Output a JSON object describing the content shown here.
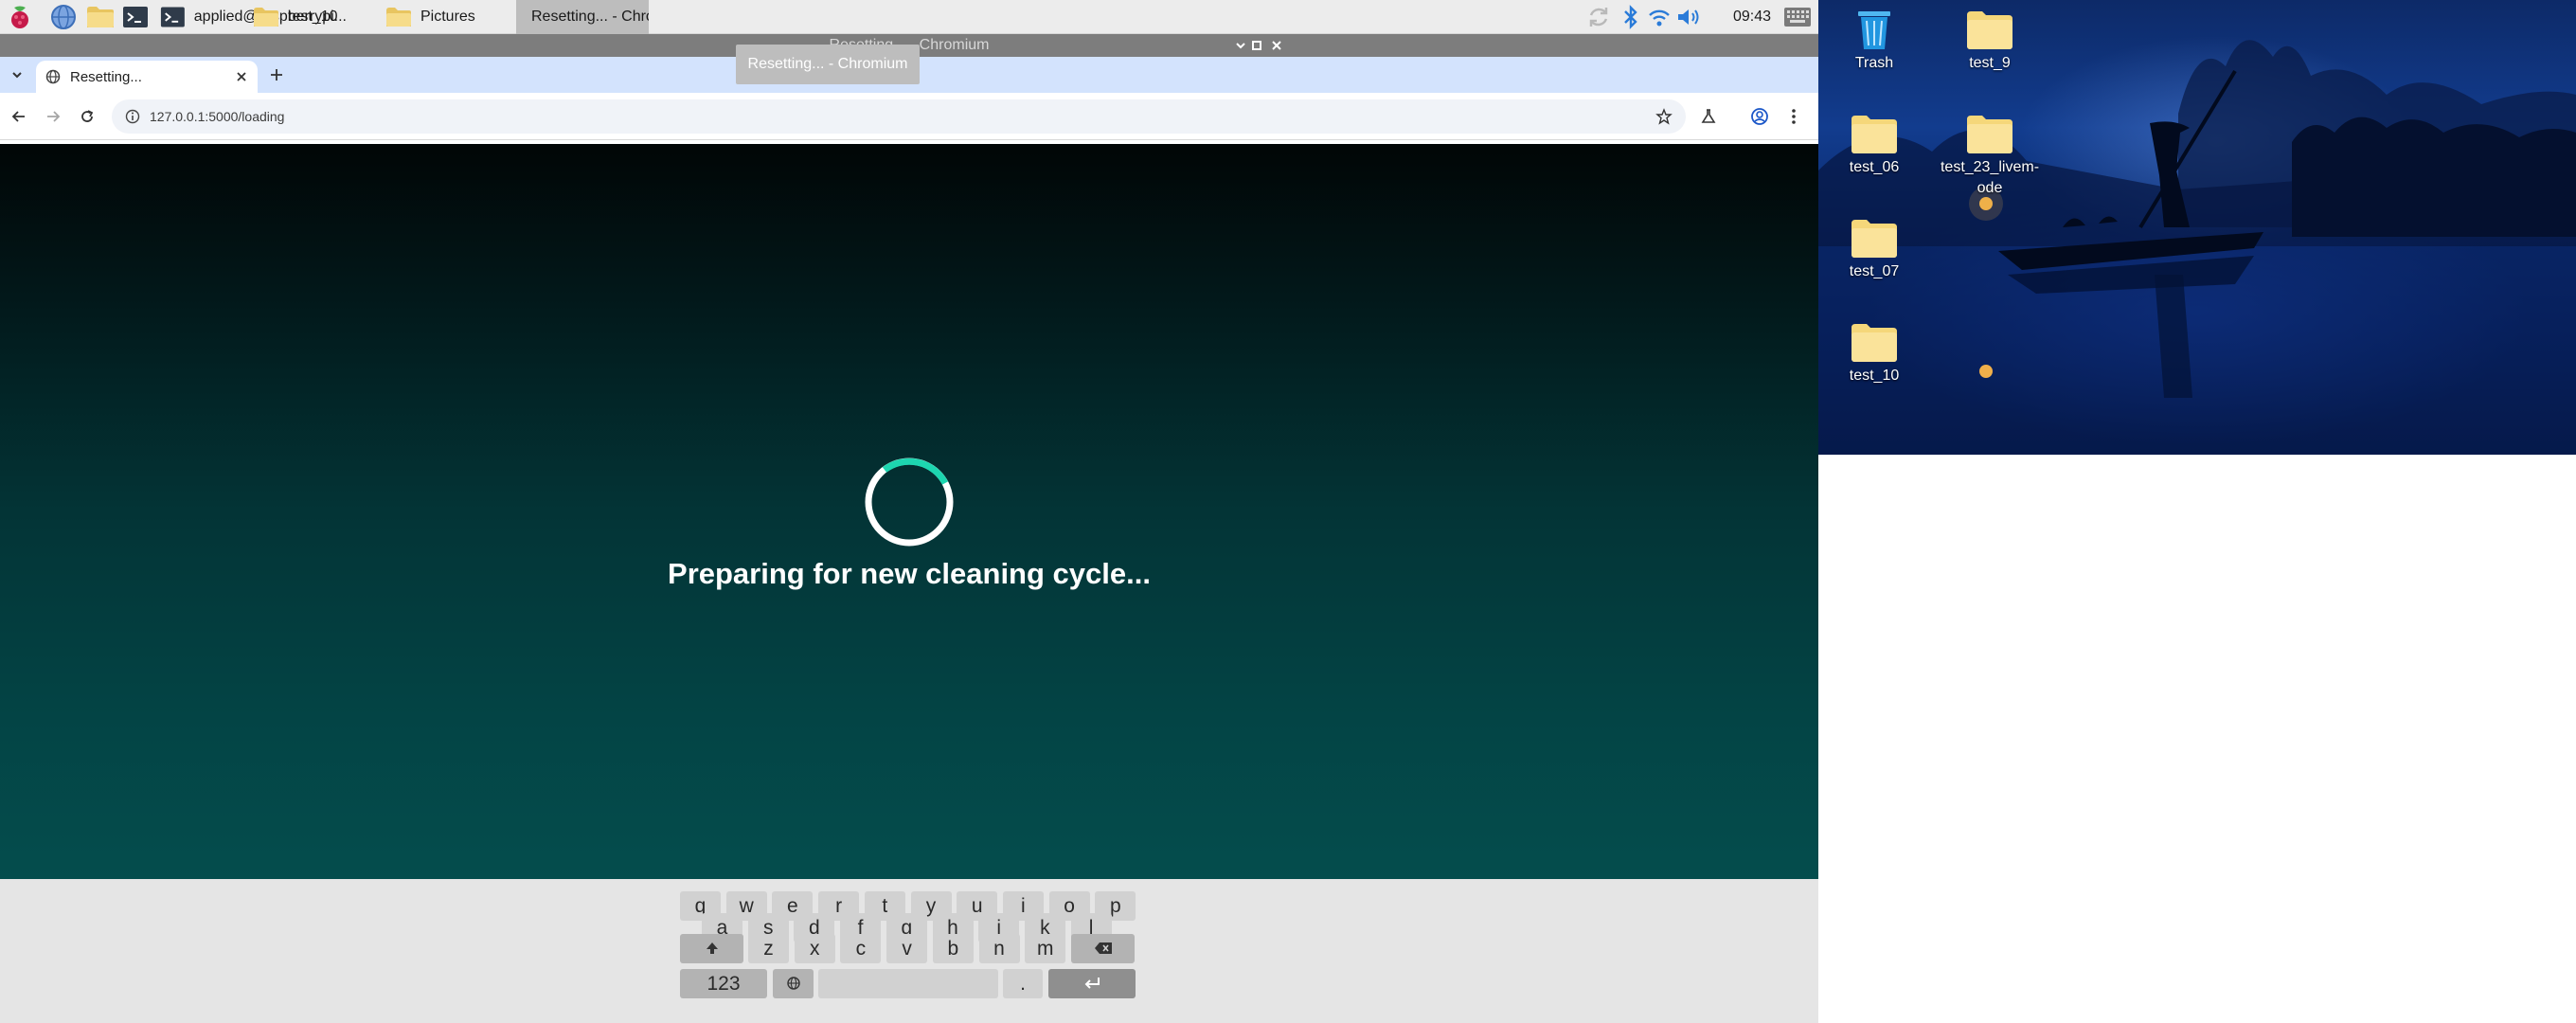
{
  "taskbar": {
    "tasks": [
      {
        "label": "applied@raspberrypi..."
      },
      {
        "label": "test_10"
      },
      {
        "label": "Pictures"
      },
      {
        "label": "Resetting... - Chromiu..."
      }
    ],
    "clock": "09:43"
  },
  "window": {
    "title": "Resetting... - Chromium",
    "tooltip": "Resetting... - Chromium"
  },
  "browser": {
    "tab_title": "Resetting...",
    "url": "127.0.0.1:5000/loading"
  },
  "page": {
    "loading_text": "Preparing for new cleaning cycle...",
    "spinner_color": "#1dd6b0"
  },
  "desktop": {
    "icons": [
      {
        "label": "Trash"
      },
      {
        "label": "test_9"
      },
      {
        "label": "test_06"
      },
      {
        "label": "test_23_livem-ode"
      },
      {
        "label": "test_07"
      },
      {
        "label": "test_10"
      }
    ]
  },
  "keyboard": {
    "row1": [
      "q",
      "w",
      "e",
      "r",
      "t",
      "y",
      "u",
      "i",
      "o",
      "p"
    ],
    "row2": [
      "a",
      "s",
      "d",
      "f",
      "g",
      "h",
      "j",
      "k",
      "l"
    ],
    "row3": [
      "z",
      "x",
      "c",
      "v",
      "b",
      "n",
      "m"
    ],
    "numbers_label": "123",
    "period_label": "."
  }
}
